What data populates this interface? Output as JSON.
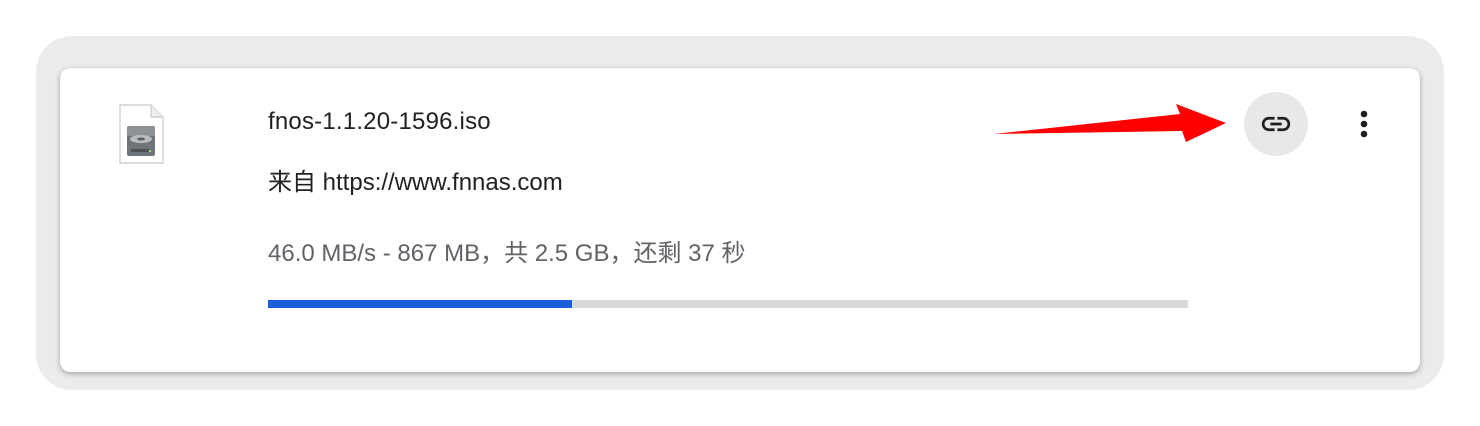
{
  "download": {
    "file_name": "fnos-1.1.20-1596.iso",
    "source": "来自 https://www.fnnas.com",
    "status": "46.0 MB/s - 867 MB，共 2.5 GB，还剩 37 秒",
    "progress_fraction": 0.33
  },
  "icons": {
    "file": "disk-image-file-icon",
    "copy_link": "link-icon",
    "more": "more-vert-icon"
  },
  "annotation": {
    "arrow_color": "#ff0000"
  },
  "colors": {
    "progress_fill": "#1a5ddb",
    "progress_track": "#d9d9d9",
    "button_bg": "#e8e8e8"
  }
}
